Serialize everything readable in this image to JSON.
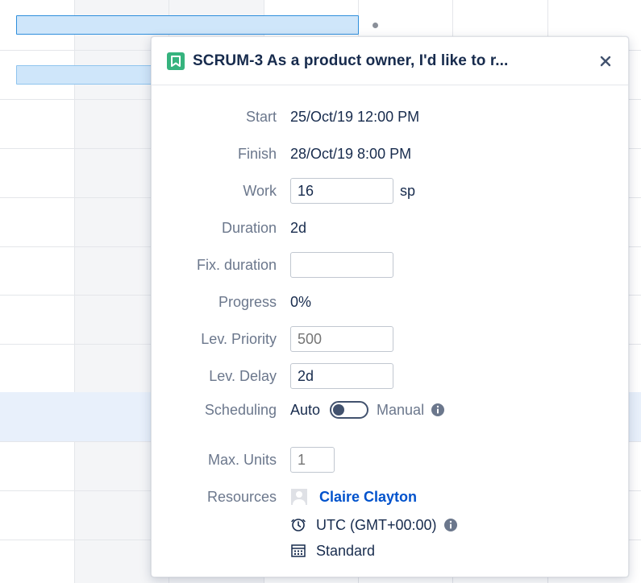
{
  "issue": {
    "key_title": "SCRUM-3 As a product owner, I'd like to r...",
    "type_icon": "story-bookmark-icon",
    "type_color": "#36b37e"
  },
  "fields": {
    "start": {
      "label": "Start",
      "value": "25/Oct/19 12:00 PM"
    },
    "finish": {
      "label": "Finish",
      "value": "28/Oct/19 8:00 PM"
    },
    "work": {
      "label": "Work",
      "value": "16",
      "unit": "sp"
    },
    "duration": {
      "label": "Duration",
      "value": "2d"
    },
    "fix_duration": {
      "label": "Fix. duration",
      "value": ""
    },
    "progress": {
      "label": "Progress",
      "value": "0%"
    },
    "lev_priority": {
      "label": "Lev. Priority",
      "value": "",
      "placeholder": "500"
    },
    "lev_delay": {
      "label": "Lev. Delay",
      "value": "2d"
    },
    "scheduling": {
      "label": "Scheduling",
      "auto_label": "Auto",
      "manual_label": "Manual",
      "is_manual": false
    },
    "max_units": {
      "label": "Max. Units",
      "value": "",
      "placeholder": "1"
    },
    "resources": {
      "label": "Resources",
      "name": "Claire Clayton",
      "timezone": "UTC (GMT+00:00)",
      "calendar": "Standard"
    }
  },
  "colors": {
    "link": "#0052cc",
    "label": "#6b778c",
    "bar_fill": "#cfe6fa",
    "bar_border": "#2f8fdc"
  }
}
